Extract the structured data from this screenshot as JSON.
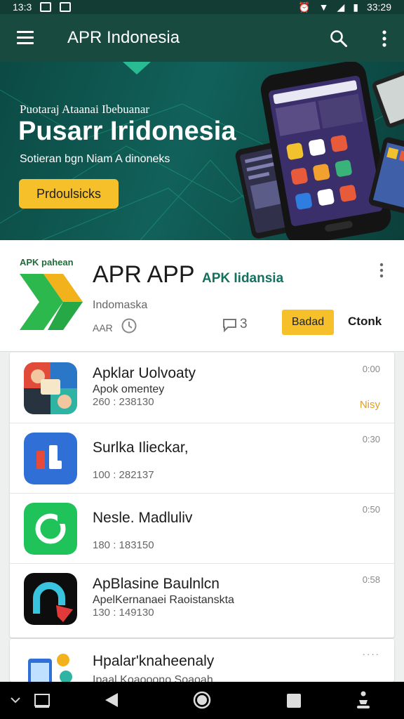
{
  "status_bar": {
    "time_left": "13:3",
    "time_right": "33:29"
  },
  "app_bar": {
    "title": "APR Indonesia",
    "icons": [
      "menu-icon",
      "search-icon",
      "more-vert-icon"
    ]
  },
  "banner": {
    "subtitle_top": "Puotaraj Ataanai Ibebuanar",
    "headline": "Pusarr Iridonesia",
    "subtitle_bottom": "Sotieran bgn Niam A dinoneks",
    "cta_label": "Prdoulsicks"
  },
  "app_header": {
    "tag": "APK pahean",
    "name": "APR APP",
    "subtitle": "APK Iidansia",
    "developer": "Indomaska",
    "meta": "AAR",
    "rating": "3",
    "primary_button": "Badad",
    "secondary_button": "Ctonk"
  },
  "list": {
    "items": [
      {
        "name": "Apklar Uolvoaty",
        "desc": "Apok omentey",
        "count": "260 : 238130",
        "time": "0:00",
        "badge": "Nisy"
      },
      {
        "name": "Surlka Ilieckar,",
        "count": "100 : 282137",
        "time": "0:30"
      },
      {
        "name": "Nesle. Madluliv",
        "count": "180 : 183150",
        "time": "0:50"
      },
      {
        "name": "ApBlasine Baulnlcn",
        "desc": "ApelKernanaei Raoistanskta",
        "count": "130 : 149130",
        "time": "0:58"
      },
      {
        "name": "Hpalar'knaheenaly",
        "desc": "Ipaal Koaooono Soaoah",
        "time": "····"
      }
    ]
  },
  "colors": {
    "toolbar": "#184a40",
    "accent": "#f5c02a",
    "brand_green": "#16705f"
  }
}
